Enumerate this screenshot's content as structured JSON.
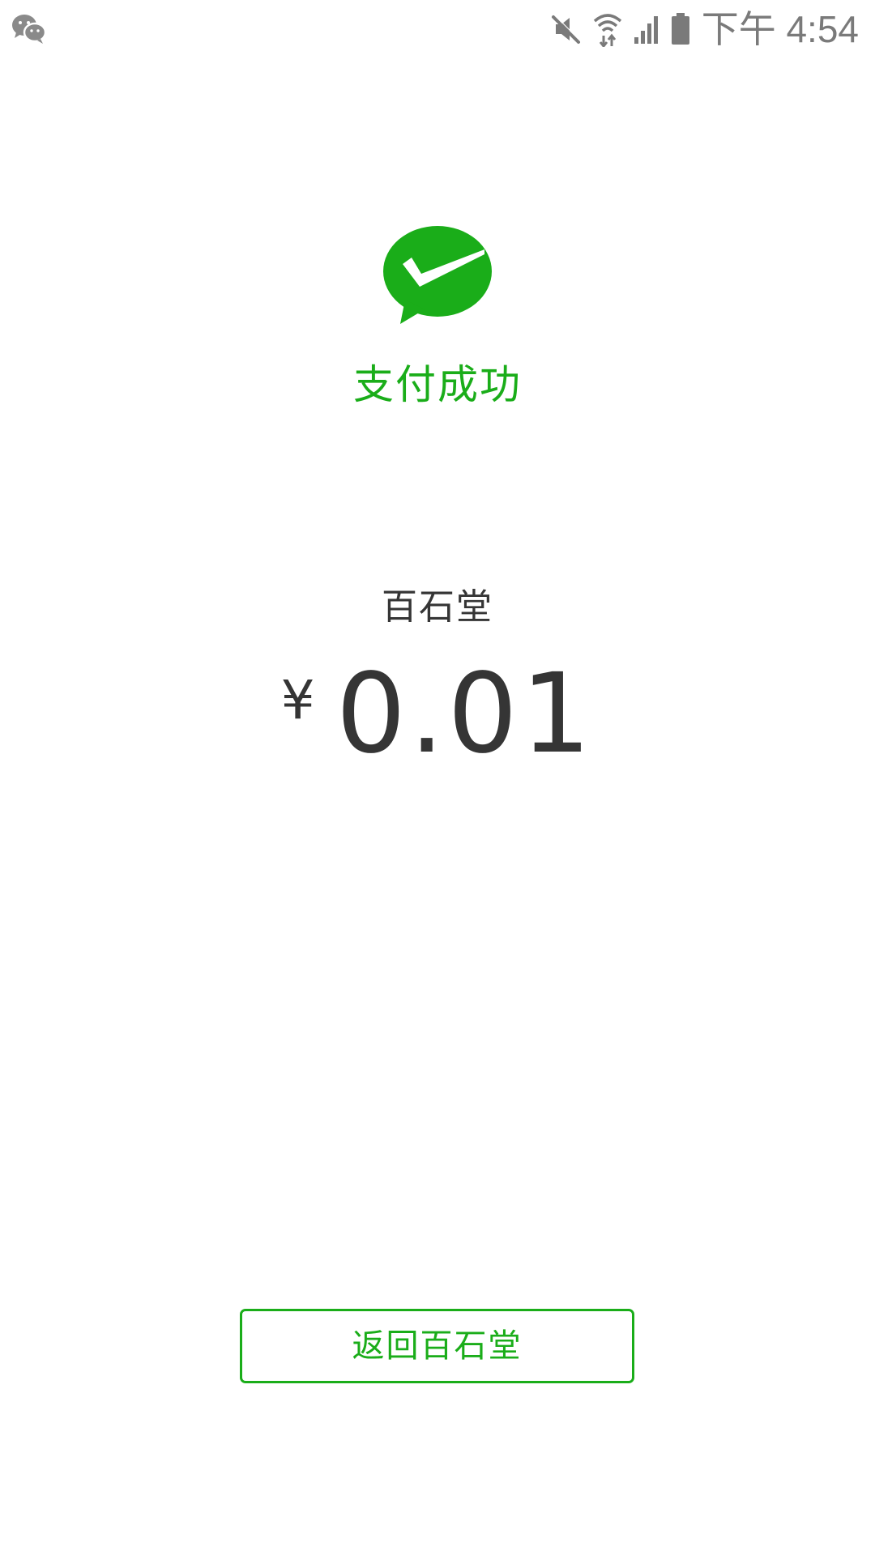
{
  "status_bar": {
    "time": "下午 4:54",
    "left_icon": "wechat-notification-icon",
    "right_icons": [
      "mute-icon",
      "wifi-icon",
      "signal-icon",
      "battery-icon"
    ]
  },
  "result": {
    "icon": "wechat-pay-success-icon",
    "title": "支付成功"
  },
  "payment": {
    "merchant": "百石堂",
    "currency_symbol": "¥",
    "amount": "0.01"
  },
  "actions": {
    "return_label": "返回百石堂"
  },
  "colors": {
    "accent": "#1aad19",
    "text": "#353535",
    "status": "#7a7a7a",
    "background": "#ffffff"
  }
}
